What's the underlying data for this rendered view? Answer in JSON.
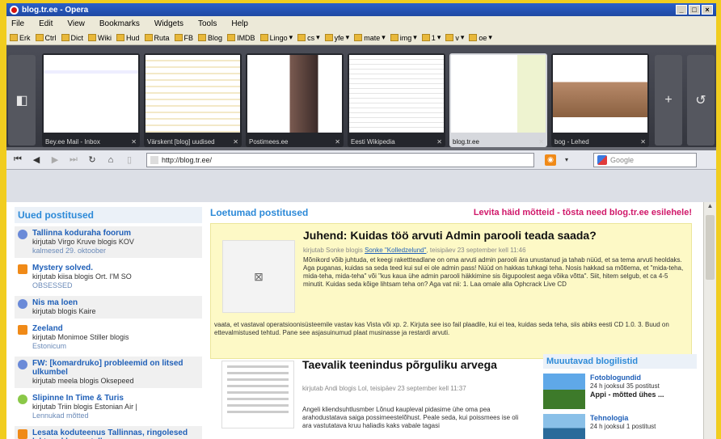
{
  "window": {
    "title": "blog.tr.ee - Opera"
  },
  "menu": [
    "File",
    "Edit",
    "View",
    "Bookmarks",
    "Widgets",
    "Tools",
    "Help"
  ],
  "bookmarks": [
    "Erk",
    "Ctrl",
    "Dict",
    "Wiki",
    "Hud",
    "Ruta",
    "FB",
    "Blog",
    "IMDB",
    "Lingo",
    "cs",
    "yfe",
    "mate",
    "img",
    "1",
    "v",
    "oe"
  ],
  "speed_dial": [
    {
      "caption": "Bey.ee Mail - Inbox"
    },
    {
      "caption": "Värskent [blog] uudised"
    },
    {
      "caption": "Postimees.ee"
    },
    {
      "caption": "Eesti Wikipedia"
    },
    {
      "caption": "blog.tr.ee"
    },
    {
      "caption": "bog - Lehed"
    }
  ],
  "address": {
    "url": "http://blog.tr.ee/"
  },
  "search": {
    "placeholder": "Google"
  },
  "sidebar": {
    "title": "Uued postitused",
    "items": [
      {
        "title": "Tallinna koduraha foorum",
        "meta": "kirjutab Virgo Kruve blogis KOV",
        "date": "kalmesed 29. oktoober"
      },
      {
        "title": "Mystery solved.",
        "meta": "kirjutab kiisa blogis Ort. I'M SO",
        "date": "OBSESSED"
      },
      {
        "title": "Nis ma loen",
        "meta": "kirjutab blogis Kaire",
        "date": ""
      },
      {
        "title": "Zeeland",
        "meta": "kirjutab Monimoe Stiller blogis",
        "date": "Estonicum"
      },
      {
        "title": "FW: [komardruko] probleemid on litsed ulkumbel",
        "meta": "kirjutab meela blogis Oksepeed",
        "date": ""
      },
      {
        "title": "Slipinne In Time & Turis",
        "meta": "kirjutab Triin blogis Estonian Air |",
        "date": "Lennukad mõtted"
      },
      {
        "title": "Lesata koduteenus Tallinnas, ringolesed lektrvad koeas telle",
        "meta": "",
        "date": ""
      }
    ]
  },
  "main": {
    "section_title": "Loetumad postitused",
    "promo": "Levita häid mõtteid - tõsta need blog.tr.ee esilehele!",
    "featured": {
      "title": "Juhend: Kuidas töö arvuti Admin parooli teada saada?",
      "meta_prefix": "kirjutab Sonke blogis",
      "meta_link": "Sonke \"Kolledzelund\"",
      "meta_date": "teisipäev 23 september kell 11:46",
      "body": "Mõnikord võib juhtuda, et keegi rakettteadlane on oma arvuti admin parooli ära unustanud ja tahab nüüd, et sa tema arvuti heoldaks. Aga puganas, kuidas sa seda teed kui sul ei ole admin pass! Nüüd on hakkas tuhkagi teha. Nosis hakkad sa mõtlema, et \"mida-teha, mida-teha, mida-teha\" või \"kus kaua ühe admin parooli häkkimine sis õigupoolest aega võika võtta\". Siit, hitem selgub, et ca 4-5 minutit. Kuidas seda kõige lihtsam teha on? Aga vat nii: 1. Laa omale alla Ophcrack Live CD",
      "body2": "vaata, et vastaval operatsioonisüsteemile vastav kas Vista või xp. 2. Kirjuta see iso fail plaadile, kui ei tea, kuidas seda teha, siis abiks eesti CD 1.0. 3. Buud on ettevalmistused tehtud. Pane see asjasuinumud plaat musinasse ja restardi arvuti."
    },
    "post2": {
      "title": "Taevalik teenindus põrguliku arvega",
      "meta": "kirjutab Andi blogis Lol, teisipäev 23 september kell 11:37",
      "body": "Angeli kliendsuhtlusmber Lõnud kaupleval pidasime ühe oma pea arahodustatava saiga possimeestelõhust. Peale seda, kui poissmees ise oli ara vastutatava kruu haliadis kaks vabale tagasi"
    }
  },
  "right_box": {
    "title": "Muuutavad blogilistid",
    "items": [
      {
        "title": "Fotoblogundid",
        "text": "24 h jooksul 35 postitust",
        "extra": "Appi - mõtted ühes ..."
      },
      {
        "title": "Tehnologia",
        "text": "24 h jooksul 1 postitust",
        "extra": ""
      }
    ]
  },
  "colors": {
    "background": "#f1cd1f",
    "accent": "#2d8ad8",
    "promo": "#d0186a",
    "featured_bg": "#fdf9c6"
  }
}
